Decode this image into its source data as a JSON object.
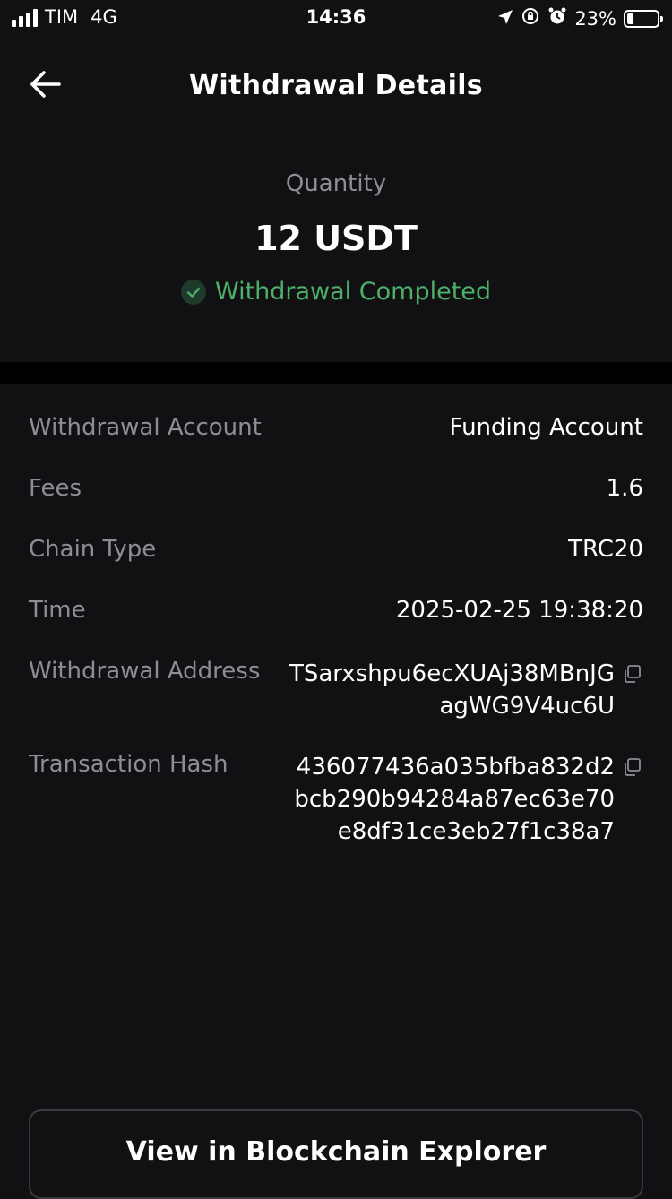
{
  "status_bar": {
    "carrier": "TIM",
    "network": "4G",
    "time": "14:36",
    "battery_percent": "23%",
    "battery_level": 0.23,
    "icons": [
      "signal-icon",
      "location-arrow-icon",
      "rotation-lock-icon",
      "alarm-icon",
      "battery-icon"
    ]
  },
  "header": {
    "title": "Withdrawal Details",
    "back_icon": "arrow-left-icon"
  },
  "summary": {
    "quantity_label": "Quantity",
    "quantity_value": "12 USDT",
    "status_text": "Withdrawal Completed",
    "status_icon": "check-circle-icon",
    "status_color": "#4db06a"
  },
  "details": {
    "withdrawal_account": {
      "label": "Withdrawal Account",
      "value": "Funding Account"
    },
    "fees": {
      "label": "Fees",
      "value": "1.6"
    },
    "chain_type": {
      "label": "Chain Type",
      "value": "TRC20"
    },
    "time": {
      "label": "Time",
      "value": "2025-02-25 19:38:20"
    },
    "withdrawal_address": {
      "label": "Withdrawal Address",
      "lines": [
        "TSarxshpu6ecXUAj38MBnJG",
        "agWG9V4uc6U"
      ],
      "copy_icon": "copy-icon"
    },
    "transaction_hash": {
      "label": "Transaction Hash",
      "lines": [
        "436077436a035bfba832d2",
        "bcb290b94284a87ec63e70",
        "e8df31ce3eb27f1c38a7"
      ],
      "copy_icon": "copy-icon"
    }
  },
  "footer": {
    "explorer_button_label": "View in Blockchain Explorer"
  },
  "colors": {
    "background": "#111113",
    "label_gray": "#8d8e94",
    "success_green": "#4db06a"
  }
}
